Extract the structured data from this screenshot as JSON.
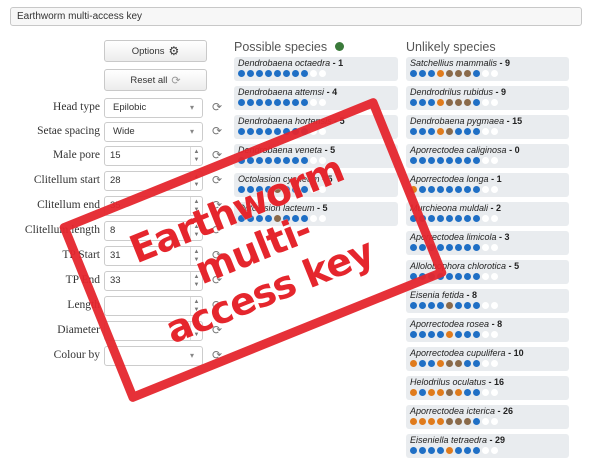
{
  "title": "Earthworm multi-access key",
  "buttons": {
    "options": "Options",
    "reset_all": "Reset all"
  },
  "fields": [
    {
      "label": "Head type",
      "type": "select",
      "value": "Epilobic"
    },
    {
      "label": "Setae spacing",
      "type": "select",
      "value": "Wide"
    },
    {
      "label": "Male pore",
      "type": "number",
      "value": "15"
    },
    {
      "label": "Clitellum start",
      "type": "number",
      "value": "28"
    },
    {
      "label": "Clitellum end",
      "type": "number",
      "value": "35"
    },
    {
      "label": "Clitellum length",
      "type": "number",
      "value": "8"
    },
    {
      "label": "TP Start",
      "type": "number",
      "value": "31"
    },
    {
      "label": "TP End",
      "type": "number",
      "value": "33"
    },
    {
      "label": "Length",
      "type": "number",
      "value": ""
    },
    {
      "label": "Diameter",
      "type": "number",
      "value": ""
    },
    {
      "label": "Colour by",
      "type": "select",
      "value": ""
    }
  ],
  "columns": {
    "possible": "Possible species",
    "unlikely": "Unlikely species"
  },
  "colors": {
    "blue": "#1f6fc5",
    "orange": "#e07b1c",
    "brown": "#8a6a4a",
    "white": "#ffffff",
    "green": "#3a7a3a",
    "stamp": "#e5262d"
  },
  "possible": [
    {
      "name": "Dendrobaena octaedra",
      "score": "1",
      "dots": "bbbbbbbbww"
    },
    {
      "name": "Dendrobaena attemsi",
      "score": "4",
      "dots": "bbbbbbbbww"
    },
    {
      "name": "Dendrobaena hortensis",
      "score": "5",
      "dots": "bbbbbbbbww"
    },
    {
      "name": "Dendrobaena veneta",
      "score": "5",
      "dots": "bbbbbbbbww"
    },
    {
      "name": "Octolasion cyaneum",
      "score": "5",
      "dots": "bbbbnbbbww"
    },
    {
      "name": "Octolasion lacteum",
      "score": "5",
      "dots": "bbbbnbbbww"
    }
  ],
  "unlikely": [
    {
      "name": "Satchellius mammalis",
      "score": "9",
      "dots": "bbbonnnbww"
    },
    {
      "name": "Dendrodrilus rubidus",
      "score": "9",
      "dots": "bbbonnnbww"
    },
    {
      "name": "Dendrobaena pygmaea",
      "score": "15",
      "dots": "bbbonbbbww"
    },
    {
      "name": "Aporrectodea caliginosa",
      "score": "0",
      "dots": "bbbbbbbbww"
    },
    {
      "name": "Aporrectodea longa",
      "score": "1",
      "dots": "obbbbbbbww"
    },
    {
      "name": "Murchieona muldali",
      "score": "2",
      "dots": "bbbbbbbbww"
    },
    {
      "name": "Aporrectodea limicola",
      "score": "3",
      "dots": "bbbbbbbbww"
    },
    {
      "name": "Allolobophora chlorotica",
      "score": "5",
      "dots": "bbbbbbbbww"
    },
    {
      "name": "Eisenia fetida",
      "score": "8",
      "dots": "bbbbnbbbww"
    },
    {
      "name": "Aporrectodea rosea",
      "score": "8",
      "dots": "bbbbobbbww"
    },
    {
      "name": "Aporrectodea cupulifera",
      "score": "10",
      "dots": "obbonnbbww"
    },
    {
      "name": "Helodrilus oculatus",
      "score": "16",
      "dots": "oboonobbww"
    },
    {
      "name": "Aporrectodea icterica",
      "score": "26",
      "dots": "oooonnnbww"
    },
    {
      "name": "Eiseniella tetraedra",
      "score": "29",
      "dots": "bbbbobbbww"
    }
  ],
  "stamp": {
    "line1": "Earthworm multi-",
    "line2": "access key"
  }
}
